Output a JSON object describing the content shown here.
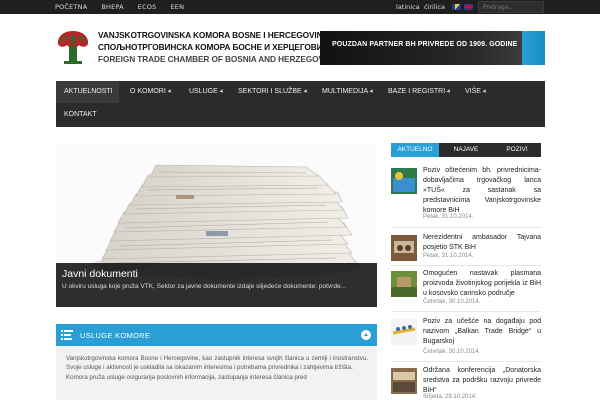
{
  "topbar": {
    "links": [
      "POČETNA",
      "BHEPA",
      "ECOS",
      "EEN"
    ],
    "lang_latin": "latinica",
    "lang_cyrillic": "ćirilica",
    "search_placeholder": "Pretraga..."
  },
  "header": {
    "name_bs": "VANJSKOTRGOVINSKA KOMORA BOSNE I HERCEGOVINE",
    "name_sr": "СПОЉНОТРГОВИНСКА КОМОРА БОСНЕ И ХЕРЦЕГОВИНЕ",
    "name_en": "FOREIGN TRADE CHAMBER OF BOSNIA AND HERZEGOVINA",
    "banner": "POUZDAN PARTNER BH PRIVREDE OD 1909. GODINE"
  },
  "nav": {
    "items": [
      "AKTUELNOSTI",
      "O KOMORI",
      "USLUGE",
      "SEKTORI I SLUŽBE",
      "MULTIMEDIJA",
      "BAZE I REGISTRI",
      "VIŠE",
      "KONTAKT"
    ]
  },
  "hero": {
    "title": "Javni dokumenti",
    "text": "U okviru usluga koje pruža VTK, Sektor za javne dokumente izdaje slijedeće dokumente: potvrde..."
  },
  "services": {
    "title": "USLUGE KOMORE",
    "p1": "Vanjskotrgovinska komora Bosne i Hercegovine, kao zastupnik interesa svojih članica u zemlji i inostranstvu. Svoje usluge i aktivnosti je uskladila sa iskazanim interesima i potrebama privrednika i zahtjevima tržišta.",
    "p2": "Komora pruža usluge osiguranja poslovnih informacija, zastupanja interesa članica pred"
  },
  "tabs": {
    "items": [
      "AKTUELNO",
      "NAJAVE",
      "POZIVI"
    ]
  },
  "news": [
    {
      "title": "Poziv oštećenim bh. privrednicima-dobavljačima trgovačkog lanca »TUŠ« za sastanak sa predstavnicima Vanjskotrgovinske komore BiH",
      "date": "Petak, 31.10.2014."
    },
    {
      "title": "Nerezidentni ambasador Tajvana posjetio STK BiH",
      "date": "Petak, 31.10.2014."
    },
    {
      "title": "Omogućen nastavak plasmana proizvoda životinjskog porijekla iz BiH u kosovsko carinsko područje",
      "date": "Četvrtak, 30.10.2014."
    },
    {
      "title": "Poziv za učešće na događaju pod nazivom „Balkan Trade Bridge“ u Bugarskoj",
      "date": "Četvrtak, 30.10.2014."
    },
    {
      "title": "Održana konferencija „Donatorska sredstva za podršku razvoju privrede BiH“",
      "date": "Srijeda, 29.10.2014."
    }
  ],
  "colors": {
    "accent": "#2a9fd6",
    "topbar": "#1f1f1f",
    "nav": "#2b2b2b",
    "logo_red": "#b8262b",
    "logo_green": "#2e6b2a"
  }
}
